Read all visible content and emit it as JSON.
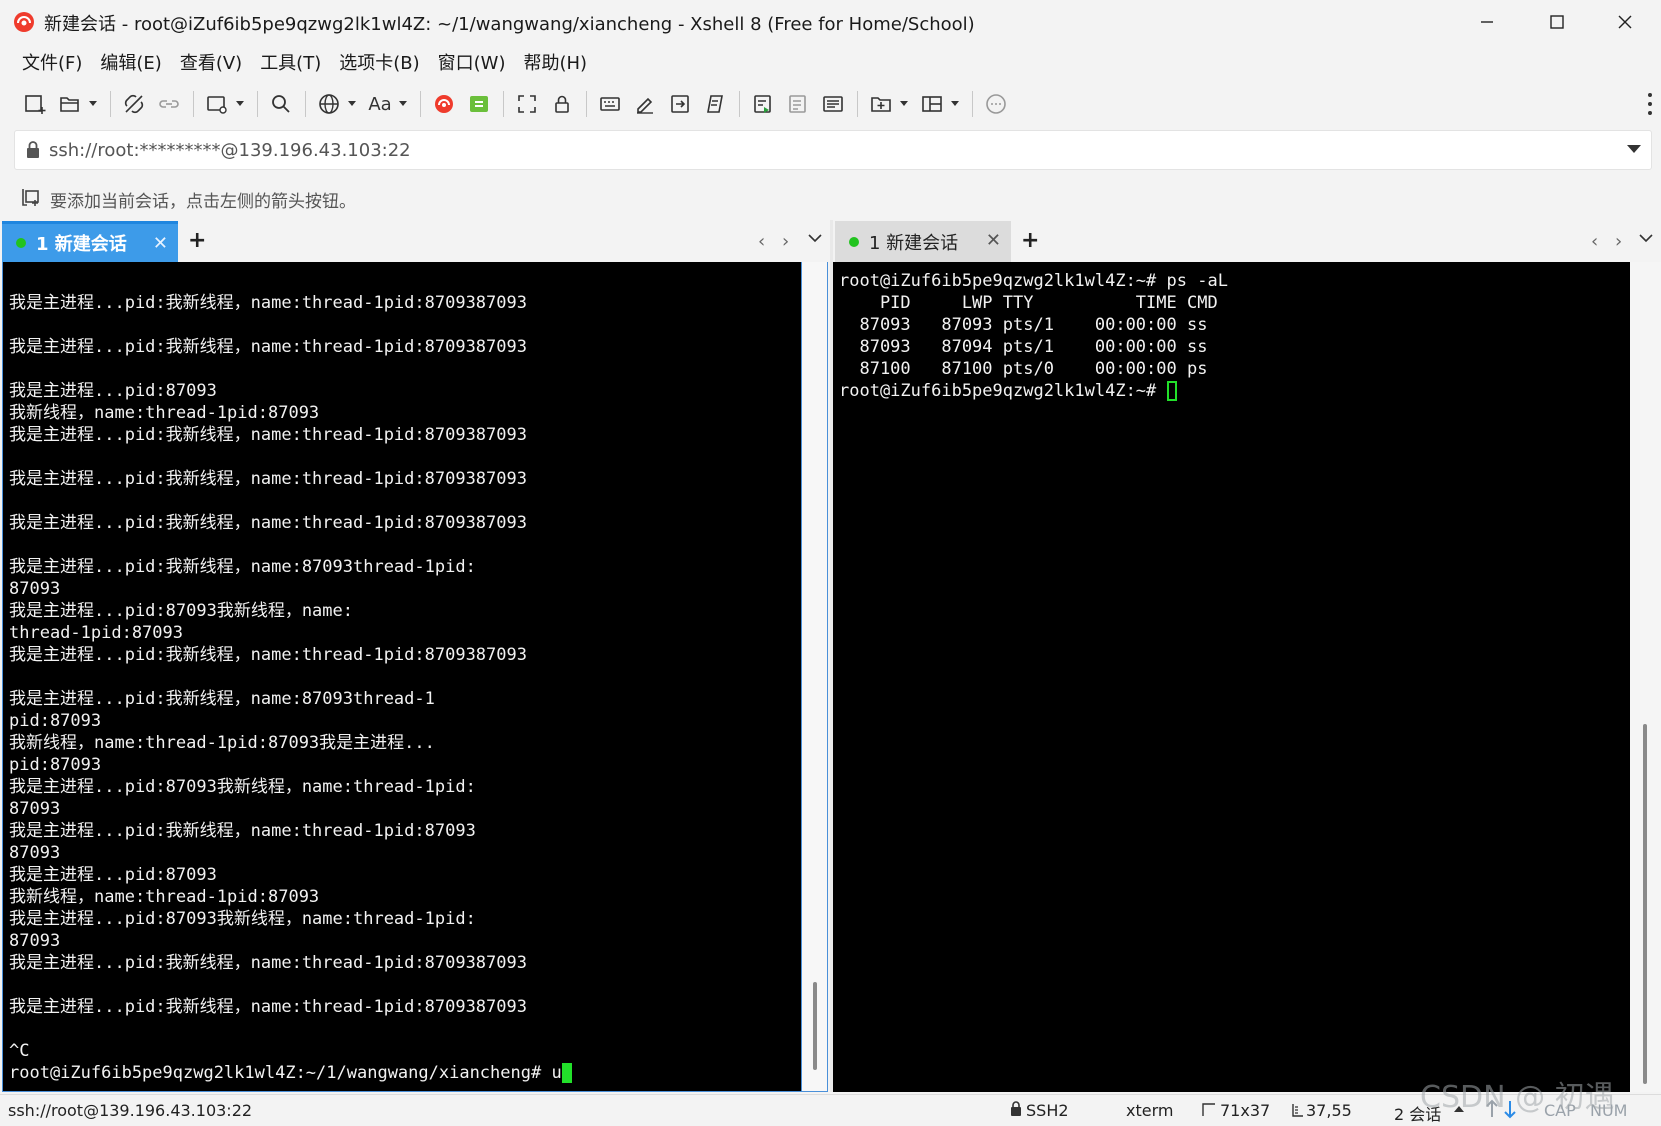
{
  "window": {
    "title": "新建会话 - root@iZuf6ib5pe9qzwg2lk1wl4Z: ~/1/wangwang/xiancheng - Xshell 8 (Free for Home/School)",
    "accent_color": "#3d9be9"
  },
  "menu": [
    "文件(F)",
    "编辑(E)",
    "查看(V)",
    "工具(T)",
    "选项卡(B)",
    "窗口(W)",
    "帮助(H)"
  ],
  "toolbar": {
    "font_label": "Aa",
    "icons": [
      "new-session-icon",
      "open-folder-icon",
      "disconnect-icon",
      "reconnect-icon",
      "new-window-icon",
      "search-icon",
      "globe-icon",
      "font-icon",
      "xshell-icon",
      "xftp-icon",
      "fullscreen-icon",
      "lock-icon",
      "keyboard-icon",
      "compose-icon",
      "transfer-icon",
      "script-icon",
      "log-icon",
      "print-icon",
      "notes-icon",
      "add-tab-icon",
      "layout-icon",
      "chat-icon"
    ]
  },
  "address": {
    "value": "ssh://root:*********@139.196.43.103:22"
  },
  "hint": {
    "text": "要添加当前会话，点击左侧的箭头按钮。"
  },
  "left_pane": {
    "tab_label": "1 新建会话",
    "lines": [
      "",
      "我是主进程...pid:我新线程，name:thread-1pid:8709387093",
      "",
      "我是主进程...pid:我新线程，name:thread-1pid:8709387093",
      "",
      "我是主进程...pid:87093",
      "我新线程，name:thread-1pid:87093",
      "我是主进程...pid:我新线程，name:thread-1pid:8709387093",
      "",
      "我是主进程...pid:我新线程，name:thread-1pid:8709387093",
      "",
      "我是主进程...pid:我新线程，name:thread-1pid:8709387093",
      "",
      "我是主进程...pid:我新线程，name:87093thread-1pid:",
      "87093",
      "我是主进程...pid:87093我新线程，name:",
      "thread-1pid:87093",
      "我是主进程...pid:我新线程，name:thread-1pid:8709387093",
      "",
      "我是主进程...pid:我新线程，name:87093thread-1",
      "pid:87093",
      "我新线程，name:thread-1pid:87093我是主进程...",
      "pid:87093",
      "我是主进程...pid:87093我新线程，name:thread-1pid:",
      "87093",
      "我是主进程...pid:我新线程，name:thread-1pid:87093",
      "87093",
      "我是主进程...pid:87093",
      "我新线程，name:thread-1pid:87093",
      "我是主进程...pid:87093我新线程，name:thread-1pid:",
      "87093",
      "我是主进程...pid:我新线程，name:thread-1pid:8709387093",
      "",
      "我是主进程...pid:我新线程，name:thread-1pid:8709387093",
      "",
      "^C"
    ],
    "prompt": "root@iZuf6ib5pe9qzwg2lk1wl4Z:~/1/wangwang/xiancheng# ",
    "input": "u"
  },
  "right_pane": {
    "tab_label": "1 新建会话",
    "lines": [
      "root@iZuf6ib5pe9qzwg2lk1wl4Z:~# ps -aL",
      "    PID     LWP TTY          TIME CMD",
      "  87093   87093 pts/1    00:00:00 ss",
      "  87093   87094 pts/1    00:00:00 ss",
      "  87100   87100 pts/0    00:00:00 ps"
    ],
    "prompt": "root@iZuf6ib5pe9qzwg2lk1wl4Z:~# "
  },
  "status": {
    "connection": "ssh://root@139.196.43.103:22",
    "protocol": "SSH2",
    "terminal": "xterm",
    "size": "71x37",
    "cursor": "37,55",
    "sessions": "2 会话",
    "cap": "CAP",
    "num": "NUM"
  },
  "watermark": "CSDN @ 初遇"
}
